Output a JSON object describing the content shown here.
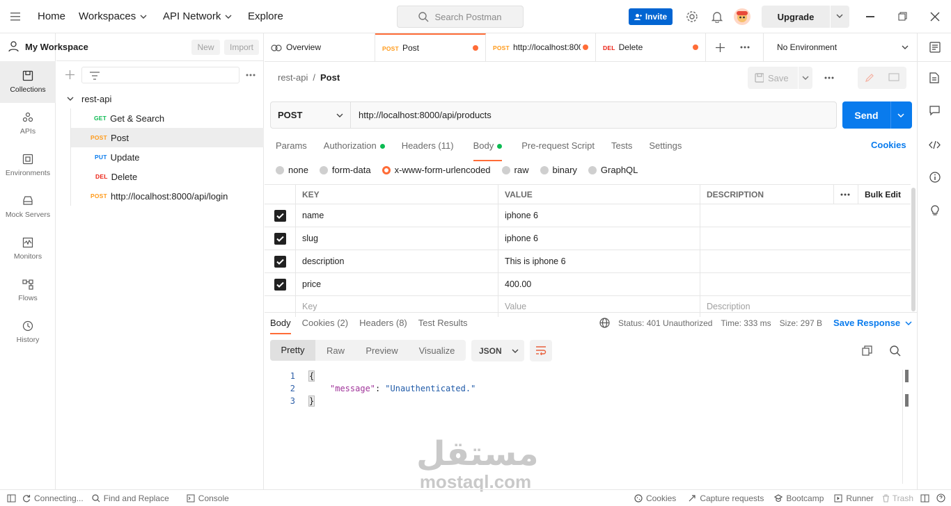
{
  "topbar": {
    "nav": [
      "Home",
      "Workspaces",
      "API Network",
      "Explore"
    ],
    "search_placeholder": "Search Postman",
    "invite_label": "Invite",
    "upgrade_label": "Upgrade"
  },
  "workspace": {
    "name": "My Workspace",
    "new_label": "New",
    "import_label": "Import"
  },
  "rail": [
    {
      "label": "Collections",
      "icon": "collections-icon",
      "active": true
    },
    {
      "label": "APIs",
      "icon": "apis-icon"
    },
    {
      "label": "Environments",
      "icon": "environments-icon"
    },
    {
      "label": "Mock Servers",
      "icon": "mock-servers-icon"
    },
    {
      "label": "Monitors",
      "icon": "monitors-icon"
    },
    {
      "label": "Flows",
      "icon": "flows-icon"
    },
    {
      "label": "History",
      "icon": "history-icon"
    }
  ],
  "collection": {
    "name": "rest-api",
    "items": [
      {
        "method": "GET",
        "name": "Get & Search"
      },
      {
        "method": "POST",
        "name": "Post"
      },
      {
        "method": "PUT",
        "name": "Update"
      },
      {
        "method": "DEL",
        "name": "Delete"
      }
    ],
    "extra": {
      "method": "POST",
      "name": "http://localhost:8000/api/login"
    }
  },
  "tabs": [
    {
      "label": "Overview",
      "method": ""
    },
    {
      "label": "Post",
      "method": "POST"
    },
    {
      "label": "http://localhost:800",
      "method": "POST"
    },
    {
      "label": "Delete",
      "method": "DEL"
    }
  ],
  "environment": "No Environment",
  "breadcrumb": {
    "parent": "rest-api",
    "sep": "/",
    "current": "Post"
  },
  "save_label": "Save",
  "request": {
    "method": "POST",
    "url": "http://localhost:8000/api/products",
    "send_label": "Send",
    "tabs": [
      "Params",
      "Authorization",
      "Headers (11)",
      "Body",
      "Pre-request Script",
      "Tests",
      "Settings"
    ],
    "cookies_label": "Cookies",
    "body_types": [
      "none",
      "form-data",
      "x-www-form-urlencoded",
      "raw",
      "binary",
      "GraphQL"
    ],
    "body_selected": "x-www-form-urlencoded"
  },
  "params_table": {
    "headers": [
      "KEY",
      "VALUE",
      "DESCRIPTION"
    ],
    "bulk_edit": "Bulk Edit",
    "rows": [
      {
        "key": "name",
        "value": "iphone 6",
        "description": ""
      },
      {
        "key": "slug",
        "value": "iphone 6",
        "description": ""
      },
      {
        "key": "description",
        "value": "This is iphone 6",
        "description": ""
      },
      {
        "key": "price",
        "value": "400.00",
        "description": ""
      }
    ],
    "placeholders": {
      "key": "Key",
      "value": "Value",
      "description": "Description"
    }
  },
  "response": {
    "tabs": [
      "Body",
      "Cookies (2)",
      "Headers (8)",
      "Test Results"
    ],
    "status": "Status: 401 Unauthorized",
    "time": "Time: 333 ms",
    "size": "Size: 297 B",
    "save_response": "Save Response",
    "views": [
      "Pretty",
      "Raw",
      "Preview",
      "Visualize"
    ],
    "format": "JSON",
    "lines": [
      "1",
      "2",
      "3"
    ],
    "json_open": "{",
    "json_key": "\"message\"",
    "json_colon": ":",
    "json_value": "\"Unauthenticated.\"",
    "json_close": "}"
  },
  "watermark": {
    "arabic": "مستقل",
    "latin": "mostaql.com"
  },
  "statusbar": {
    "connecting": "Connecting...",
    "find_replace": "Find and Replace",
    "console": "Console",
    "cookies": "Cookies",
    "capture": "Capture requests",
    "bootcamp": "Bootcamp",
    "runner": "Runner",
    "trash": "Trash"
  },
  "colors": {
    "accent": "#ff6c37",
    "primary": "#097bed",
    "invite": "#0265d2"
  }
}
